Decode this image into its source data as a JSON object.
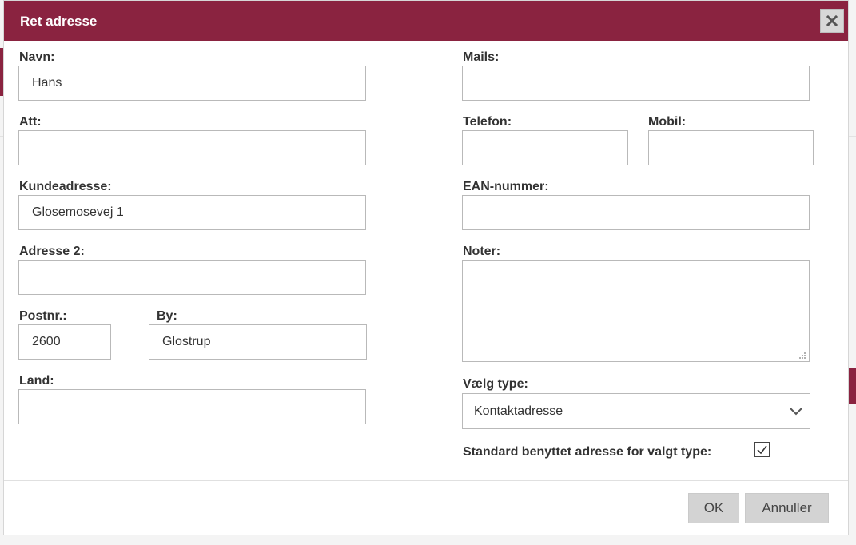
{
  "dialog": {
    "title": "Ret adresse",
    "close_icon": "close-icon"
  },
  "form": {
    "navn": {
      "label": "Navn:",
      "value": "Hans",
      "placeholder": ""
    },
    "att": {
      "label": "Att:",
      "value": "",
      "placeholder": ""
    },
    "kundeadresse": {
      "label": "Kundeadresse:",
      "value": "Glosemosevej 1",
      "placeholder": ""
    },
    "adresse2": {
      "label": "Adresse 2:",
      "value": "",
      "placeholder": ""
    },
    "postnr": {
      "label": "Postnr.:",
      "value": "2600",
      "placeholder": ""
    },
    "by": {
      "label": "By:",
      "value": "Glostrup",
      "placeholder": ""
    },
    "land": {
      "label": "Land:",
      "value": "",
      "placeholder": ""
    },
    "mails": {
      "label": "Mails:",
      "value": "",
      "placeholder": ""
    },
    "telefon": {
      "label": "Telefon:",
      "value": "",
      "placeholder": ""
    },
    "mobil": {
      "label": "Mobil:",
      "value": "",
      "placeholder": ""
    },
    "ean": {
      "label": "EAN-nummer:",
      "value": "",
      "placeholder": ""
    },
    "noter": {
      "label": "Noter:",
      "value": ""
    },
    "type": {
      "label": "Vælg type:",
      "selected": "Kontaktadresse"
    },
    "standard": {
      "label": "Standard benyttet adresse for valgt type:",
      "checked": true
    }
  },
  "buttons": {
    "ok": "OK",
    "cancel": "Annuller"
  },
  "colors": {
    "header": "#8a2340",
    "button_bg": "#d3d3d3"
  }
}
